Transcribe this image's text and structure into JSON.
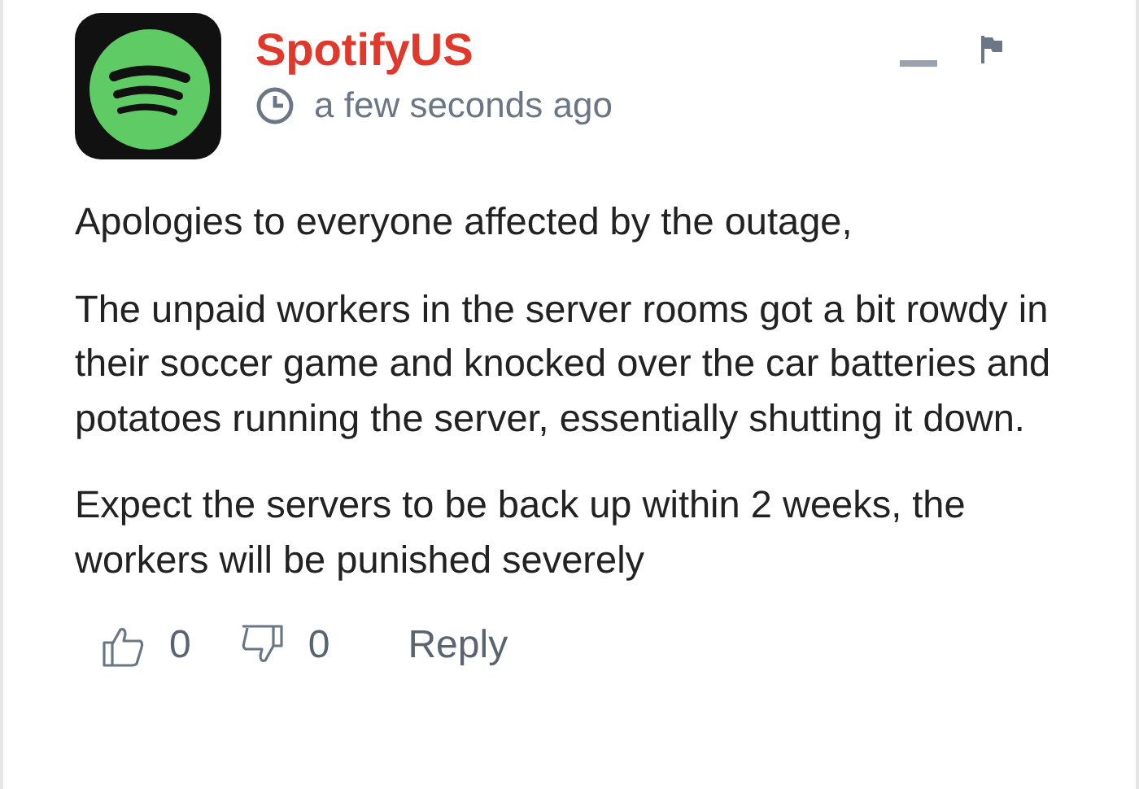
{
  "comment": {
    "author": "SpotifyUS",
    "time": "a few seconds ago",
    "paragraphs": [
      "Apologies to everyone affected by the outage,",
      "The unpaid workers in the server rooms got a bit rowdy in their soccer game and knocked over the car batteries and potatoes running the server, essentially shutting it down.",
      "Expect the servers to be back up within 2 weeks, the workers will be punished severely"
    ],
    "upvotes": "0",
    "downvotes": "0",
    "reply": "Reply"
  }
}
